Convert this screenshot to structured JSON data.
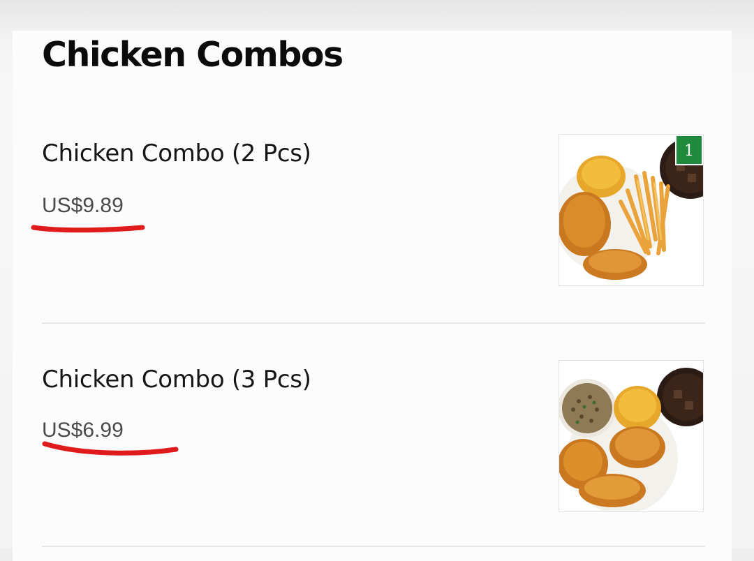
{
  "section": {
    "title": "Chicken Combos"
  },
  "items": [
    {
      "name": "Chicken Combo (2 Pcs)",
      "price": "US$9.89",
      "quantity_badge": "1",
      "image_icon": "fried-chicken-fries-drink-photo"
    },
    {
      "name": "Chicken Combo (3 Pcs)",
      "price": "US$6.99",
      "image_icon": "fried-chicken-rice-drink-photo"
    }
  ],
  "colors": {
    "badge": "#1f8a3b",
    "annotation_underline": "#e01b1b",
    "price_text": "#4a4a4a"
  }
}
